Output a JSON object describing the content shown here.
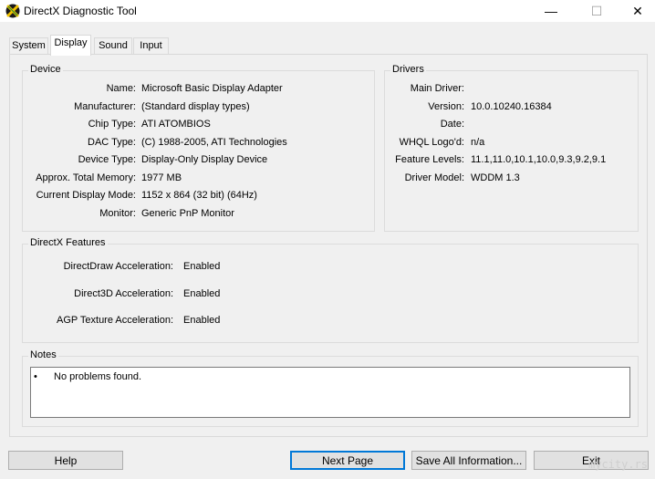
{
  "window": {
    "title": "DirectX Diagnostic Tool",
    "controls": {
      "minimize": "—",
      "maximize": "☐",
      "close": "✕"
    }
  },
  "tabs": [
    {
      "label": "System",
      "active": false
    },
    {
      "label": "Display",
      "active": true
    },
    {
      "label": "Sound",
      "active": false
    },
    {
      "label": "Input",
      "active": false
    }
  ],
  "device": {
    "title": "Device",
    "rows": [
      {
        "label": "Name:",
        "value": "Microsoft Basic Display Adapter"
      },
      {
        "label": "Manufacturer:",
        "value": "(Standard display types)"
      },
      {
        "label": "Chip Type:",
        "value": "ATI ATOMBIOS"
      },
      {
        "label": "DAC Type:",
        "value": "(C) 1988-2005, ATI Technologies"
      },
      {
        "label": "Device Type:",
        "value": "Display-Only Display Device"
      },
      {
        "label": "Approx. Total Memory:",
        "value": "1977 MB"
      },
      {
        "label": "Current Display Mode:",
        "value": "1152 x 864 (32 bit) (64Hz)"
      },
      {
        "label": "Monitor:",
        "value": "Generic PnP Monitor"
      }
    ]
  },
  "drivers": {
    "title": "Drivers",
    "rows": [
      {
        "label": "Main Driver:",
        "value": ""
      },
      {
        "label": "Version:",
        "value": "10.0.10240.16384"
      },
      {
        "label": "Date:",
        "value": ""
      },
      {
        "label": "WHQL Logo'd:",
        "value": "n/a"
      },
      {
        "label": "Feature Levels:",
        "value": "11.1,11.0,10.1,10.0,9.3,9.2,9.1"
      },
      {
        "label": "Driver Model:",
        "value": "WDDM 1.3"
      }
    ]
  },
  "directx_features": {
    "title": "DirectX Features",
    "rows": [
      {
        "label": "DirectDraw Acceleration:",
        "value": "Enabled"
      },
      {
        "label": "Direct3D Acceleration:",
        "value": "Enabled"
      },
      {
        "label": "AGP Texture Acceleration:",
        "value": "Enabled"
      }
    ]
  },
  "notes": {
    "title": "Notes",
    "bullet": "•",
    "text": "No problems found."
  },
  "buttons": {
    "help": "Help",
    "next_page": "Next Page",
    "save_all": "Save All Information...",
    "exit": "Exit"
  },
  "watermark": "mycity.rs"
}
